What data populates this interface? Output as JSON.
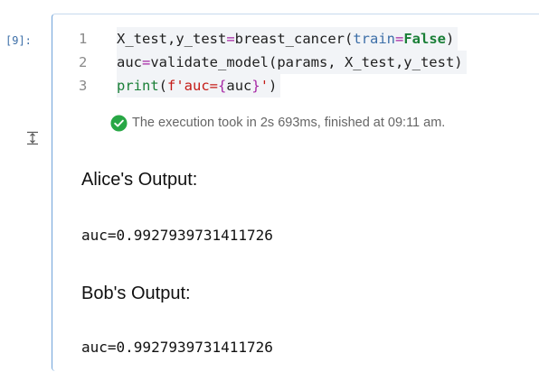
{
  "cell": {
    "prompt": "[9]:",
    "code_lines": [
      {
        "number": "1",
        "tokens": [
          {
            "text": "X_test,y_test",
            "kind": "plain"
          },
          {
            "text": "=",
            "kind": "op"
          },
          {
            "text": "breast_cancer(",
            "kind": "plain"
          },
          {
            "text": "train",
            "kind": "param"
          },
          {
            "text": "=",
            "kind": "op"
          },
          {
            "text": "False",
            "kind": "kw"
          },
          {
            "text": ")",
            "kind": "plain"
          }
        ]
      },
      {
        "number": "2",
        "tokens": [
          {
            "text": "auc",
            "kind": "plain"
          },
          {
            "text": "=",
            "kind": "op"
          },
          {
            "text": "validate_model(params, X_test,y_test)",
            "kind": "plain"
          }
        ]
      },
      {
        "number": "3",
        "tokens": [
          {
            "text": "print",
            "kind": "bi"
          },
          {
            "text": "(",
            "kind": "plain"
          },
          {
            "text": "f'auc=",
            "kind": "str"
          },
          {
            "text": "{",
            "kind": "op"
          },
          {
            "text": "auc",
            "kind": "plain"
          },
          {
            "text": "}",
            "kind": "op"
          },
          {
            "text": "'",
            "kind": "str"
          },
          {
            "text": ")",
            "kind": "plain"
          }
        ]
      }
    ],
    "status_text": "The execution took in 2s 693ms, finished at 09:11 am.",
    "status_icon": "check-circle-icon",
    "collapse_icon": "collapse-output-icon"
  },
  "output": {
    "alice_heading": "Alice's Output:",
    "alice_value": "auc=0.9927939731411726",
    "bob_heading": "Bob's Output:",
    "bob_value": "auc=0.9927939731411726"
  },
  "colors": {
    "cell_border": "#6fa3d9",
    "success_green": "#28a745",
    "prompt_blue": "#3d6fa8"
  }
}
